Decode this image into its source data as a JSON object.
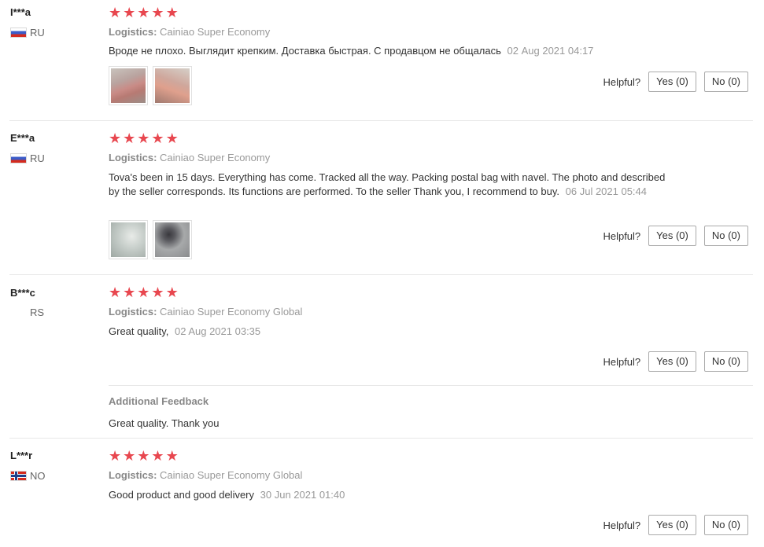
{
  "helpful_label": "Helpful?",
  "star_color": "#e8474f",
  "reviews": [
    {
      "user": "I***a",
      "country": "RU",
      "rating": 5,
      "logistics_label": "Logistics:",
      "logistics": "Cainiao Super Economy",
      "text": "Вроде не плохо. Выглядит крепким. Доставка быстрая. С продавцом не общалась",
      "date": "02 Aug 2021 04:17",
      "yes": "Yes (0)",
      "no": "No (0)"
    },
    {
      "user": "E***a",
      "country": "RU",
      "rating": 5,
      "logistics_label": "Logistics:",
      "logistics": "Cainiao Super Economy",
      "text": "Tova's been in 15 days. Everything has come. Tracked all the way. Packing postal bag with navel. The photo and described by the seller corresponds. Its functions are performed. To the seller Thank you, I recommend to buy.",
      "date": "06 Jul 2021 05:44",
      "yes": "Yes (0)",
      "no": "No (0)"
    },
    {
      "user": "B***c",
      "country": "RS",
      "rating": 5,
      "logistics_label": "Logistics:",
      "logistics": "Cainiao Super Economy Global",
      "text": "Great quality,",
      "date": "02 Aug 2021 03:35",
      "yes": "Yes (0)",
      "no": "No (0)",
      "additional_title": "Additional Feedback",
      "additional_text": "Great quality. Thank you"
    },
    {
      "user": "L***r",
      "country": "NO",
      "rating": 5,
      "logistics_label": "Logistics:",
      "logistics": "Cainiao Super Economy Global",
      "text": "Good product and good delivery",
      "date": "30 Jun 2021 01:40",
      "yes": "Yes (0)",
      "no": "No (0)"
    }
  ]
}
